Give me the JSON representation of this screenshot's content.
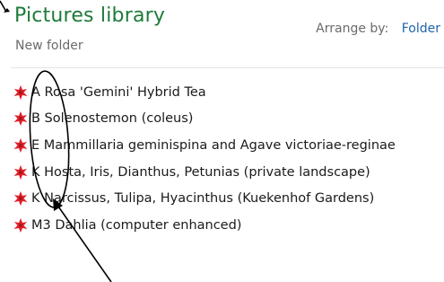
{
  "header": {
    "title": "Pictures library",
    "new_folder": "New folder",
    "arrange_label": "Arrange by:",
    "arrange_value": "Folder"
  },
  "folders": [
    {
      "label": "A Rosa 'Gemini' Hybrid Tea",
      "icon": "red-flower-icon"
    },
    {
      "label": "B Solenostemon (coleus)",
      "icon": "red-flower-icon"
    },
    {
      "label": "E Mammillaria geminispina and Agave victoriae-reginae",
      "icon": "red-flower-icon"
    },
    {
      "label": "K Hosta, Iris, Dianthus, Petunias (private landscape)",
      "icon": "red-flower-icon"
    },
    {
      "label": "K Narcissus, Tulipa, Hyacinthus (Kuekenhof Gardens)",
      "icon": "red-flower-icon"
    },
    {
      "label": "M3 Dahlia (computer enhanced)",
      "icon": "red-flower-icon"
    }
  ],
  "colors": {
    "title": "#1e7a3a",
    "link": "#1f63a8",
    "icon": "#e0202a",
    "annotation": "#000000"
  }
}
